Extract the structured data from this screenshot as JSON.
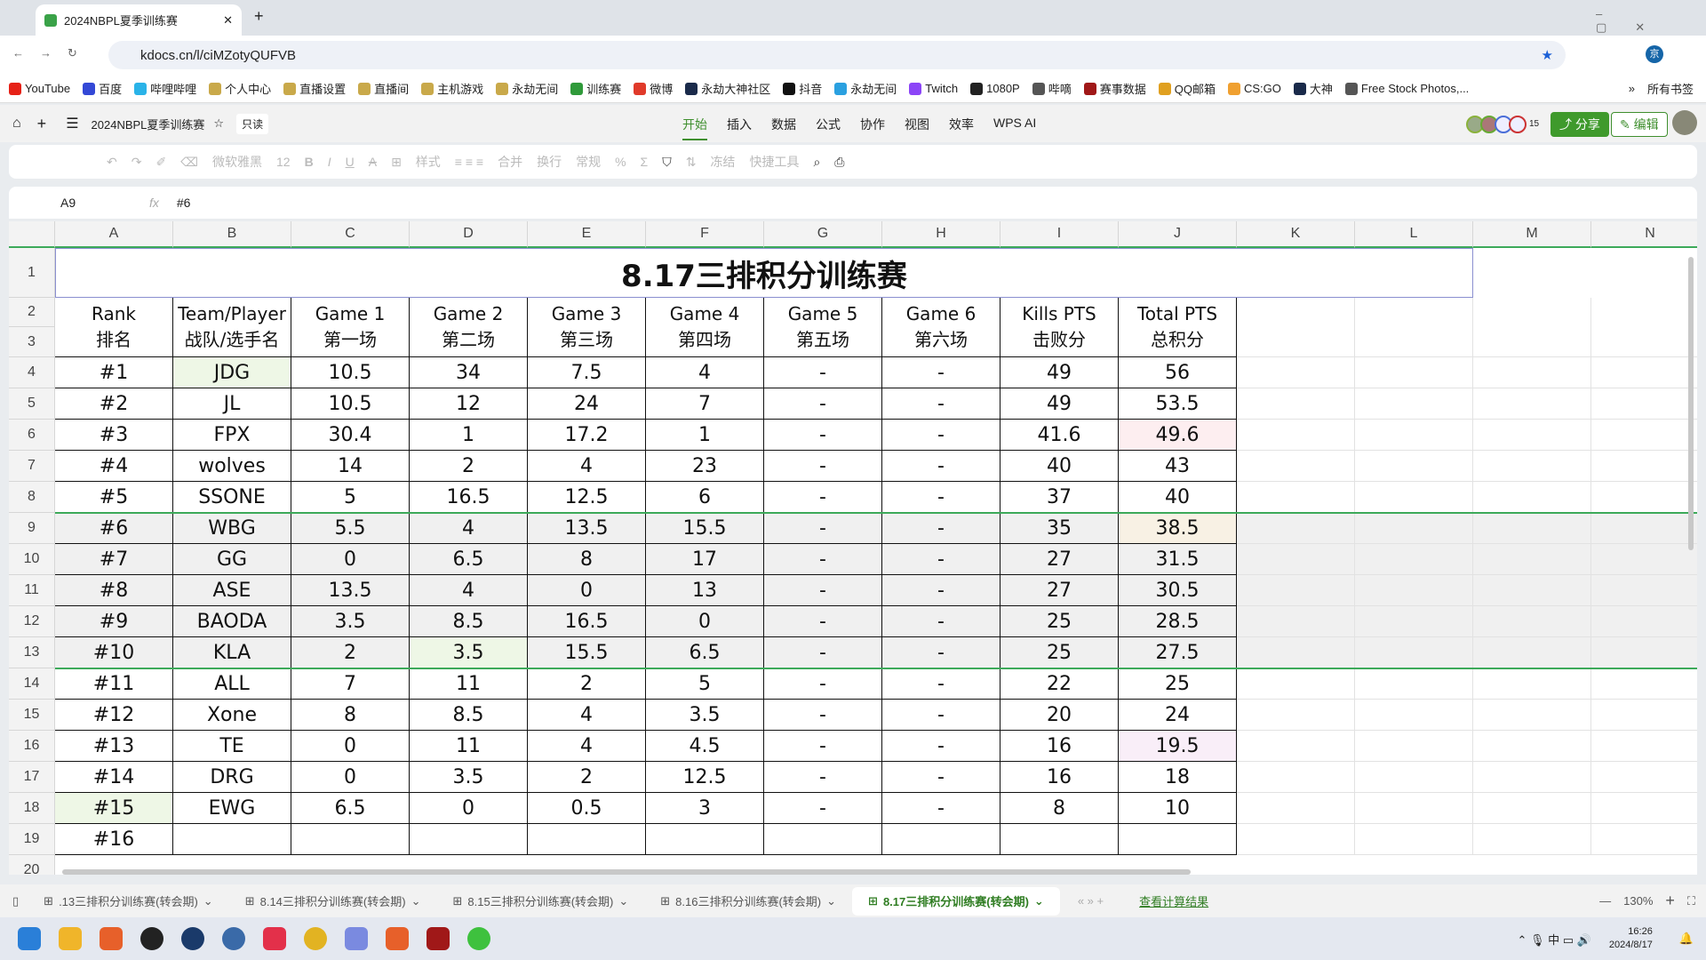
{
  "browser": {
    "tab_title": "2024NBPL夏季训练赛",
    "url": "kdocs.cn/l/ciMZotyQUFVB",
    "bookmarks": [
      "YouTube",
      "百度",
      "哔哩哔哩",
      "个人中心",
      "直播设置",
      "直播间",
      "主机游戏",
      "永劫无间",
      "训练赛",
      "微博",
      "永劫大神社区",
      "抖音",
      "永劫无间",
      "Twitch",
      "1080P",
      "哔嘀",
      "赛事数据",
      "QQ邮箱",
      "CS:GO",
      "大神",
      "Free Stock Photos,..."
    ],
    "all_bookmarks": "所有书签",
    "profile": "京"
  },
  "app": {
    "doc_title": "2024NBPL夏季训练赛",
    "readonly": "只读",
    "menu": [
      "开始",
      "插入",
      "数据",
      "公式",
      "协作",
      "视图",
      "效率",
      "WPS AI"
    ],
    "collab_count": "15",
    "share": "分享",
    "edit": "编辑"
  },
  "toolbar": {
    "font": "微软雅黑",
    "size": "12",
    "style": "样式",
    "merge": "合并",
    "wrap": "换行",
    "format": "常规",
    "freeze": "冻结",
    "quick_tools": "快捷工具"
  },
  "formula": {
    "cell_ref": "A9",
    "fx": "fx",
    "value": "#6"
  },
  "columns": [
    "A",
    "B",
    "C",
    "D",
    "E",
    "F",
    "G",
    "H",
    "I",
    "J",
    "K",
    "L",
    "M",
    "N"
  ],
  "sheet": {
    "title": "8.17三排积分训练赛",
    "headers": [
      [
        "Rank",
        "排名"
      ],
      [
        "Team/Player",
        "战队/选手名"
      ],
      [
        "Game 1",
        "第一场"
      ],
      [
        "Game 2",
        "第二场"
      ],
      [
        "Game 3",
        "第三场"
      ],
      [
        "Game 4",
        "第四场"
      ],
      [
        "Game 5",
        "第五场"
      ],
      [
        "Game 6",
        "第六场"
      ],
      [
        "Kills PTS",
        "击败分"
      ],
      [
        "Total PTS",
        "总积分"
      ]
    ],
    "rows": [
      [
        "#1",
        "JDG",
        "10.5",
        "34",
        "7.5",
        "4",
        "-",
        "-",
        "49",
        "56"
      ],
      [
        "#2",
        "JL",
        "10.5",
        "12",
        "24",
        "7",
        "-",
        "-",
        "49",
        "53.5"
      ],
      [
        "#3",
        "FPX",
        "30.4",
        "1",
        "17.2",
        "1",
        "-",
        "-",
        "41.6",
        "49.6"
      ],
      [
        "#4",
        "wolves",
        "14",
        "2",
        "4",
        "23",
        "-",
        "-",
        "40",
        "43"
      ],
      [
        "#5",
        "SSONE",
        "5",
        "16.5",
        "12.5",
        "6",
        "-",
        "-",
        "37",
        "40"
      ],
      [
        "#6",
        "WBG",
        "5.5",
        "4",
        "13.5",
        "15.5",
        "-",
        "-",
        "35",
        "38.5"
      ],
      [
        "#7",
        "GG",
        "0",
        "6.5",
        "8",
        "17",
        "-",
        "-",
        "27",
        "31.5"
      ],
      [
        "#8",
        "ASE",
        "13.5",
        "4",
        "0",
        "13",
        "-",
        "-",
        "27",
        "30.5"
      ],
      [
        "#9",
        "BAODA",
        "3.5",
        "8.5",
        "16.5",
        "0",
        "-",
        "-",
        "25",
        "28.5"
      ],
      [
        "#10",
        "KLA",
        "2",
        "3.5",
        "15.5",
        "6.5",
        "-",
        "-",
        "25",
        "27.5"
      ],
      [
        "#11",
        "ALL",
        "7",
        "11",
        "2",
        "5",
        "-",
        "-",
        "22",
        "25"
      ],
      [
        "#12",
        "Xone",
        "8",
        "8.5",
        "4",
        "3.5",
        "-",
        "-",
        "20",
        "24"
      ],
      [
        "#13",
        "TE",
        "0",
        "11",
        "4",
        "4.5",
        "-",
        "-",
        "16",
        "19.5"
      ],
      [
        "#14",
        "DRG",
        "0",
        "3.5",
        "2",
        "12.5",
        "-",
        "-",
        "16",
        "18"
      ],
      [
        "#15",
        "EWG",
        "6.5",
        "0",
        "0.5",
        "3",
        "-",
        "-",
        "8",
        "10"
      ],
      [
        "#16",
        "",
        "",
        "",
        "",
        "",
        "",
        "",
        "",
        ""
      ]
    ]
  },
  "sheet_tabs": [
    ".13三排积分训练赛(转会期)",
    "8.14三排积分训练赛(转会期)",
    "8.15三排积分训练赛(转会期)",
    "8.16三排积分训练赛(转会期)",
    "8.17三排积分训练赛(转会期)"
  ],
  "status": {
    "view_result": "查看计算结果",
    "zoom": "130%"
  },
  "clock": {
    "time": "16:26",
    "date": "2024/8/17"
  },
  "colors": {
    "accent": "#3f8f2e",
    "selection": "#3daa5a"
  }
}
